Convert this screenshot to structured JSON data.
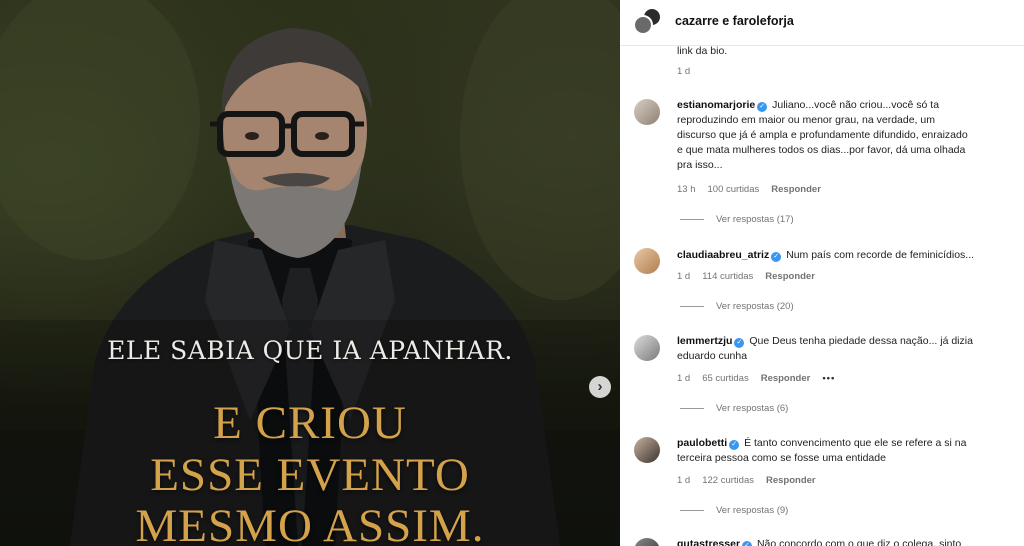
{
  "post": {
    "caption_small": "ELE SABIA QUE IA APANHAR.",
    "caption_big": [
      "E CRIOU",
      "ESSE EVENTO",
      "MESMO ASSIM."
    ],
    "next_icon": "chevron-right-icon",
    "colors": {
      "caption_small": "#ecebe6",
      "caption_big": "#d3a24b"
    }
  },
  "header": {
    "title": "cazarre e faroleforja"
  },
  "prev_comment": {
    "text_tail": "link da bio.",
    "time": "1 d"
  },
  "comments": [
    {
      "username": "estianomarjorie",
      "verified": true,
      "lines": [
        "Juliano...você não criou...você só ta",
        "reproduzindo em maior ou menor grau, na verdade, um",
        "discurso que já é ampla e profundamente difundido, enraizado",
        "e que mata mulheres todos os dias...por favor, dá uma olhada",
        "pra isso..."
      ],
      "time": "13 h",
      "likes": "100 curtidas",
      "reply": "Responder",
      "replies": "Ver respostas (17)"
    },
    {
      "username": "claudiaabreu_atriz",
      "verified": true,
      "lines": [
        "Num país com recorde de feminicídios..."
      ],
      "time": "1 d",
      "likes": "114 curtidas",
      "reply": "Responder",
      "replies": "Ver respostas (20)"
    },
    {
      "username": "lemmertzju",
      "verified": true,
      "lines": [
        "Que Deus tenha piedade dessa nação... já dizia",
        "eduardo cunha"
      ],
      "time": "1 d",
      "likes": "65 curtidas",
      "reply": "Responder",
      "more": "•••",
      "replies": "Ver respostas (6)"
    },
    {
      "username": "paulobetti",
      "verified": true,
      "lines": [
        "É tanto convencimento que ele se refere a si na",
        "terceira pessoa como se fosse uma entidade"
      ],
      "time": "1 d",
      "likes": "122 curtidas",
      "reply": "Responder",
      "replies": "Ver respostas (9)"
    },
    {
      "username": "gutastresser",
      "verified": true,
      "lines": [
        "Não concordo com o que diz o colega, sinto"
      ]
    }
  ],
  "icons": {
    "verified": "verified-badge-icon"
  },
  "colors": {
    "verified": "#3897f0",
    "meta": "#737373"
  }
}
